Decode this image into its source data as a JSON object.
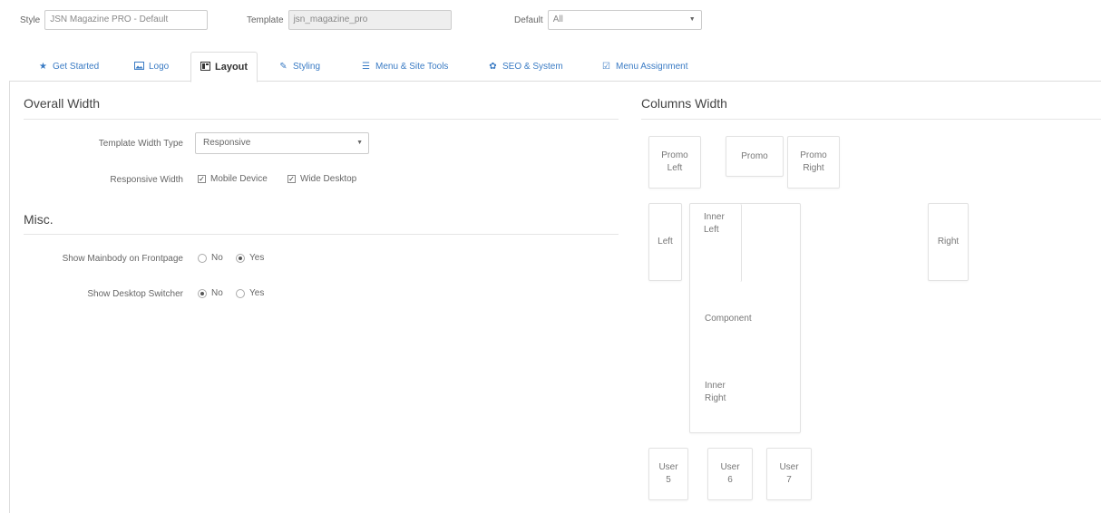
{
  "top": {
    "style_label": "Style",
    "style_value": "JSN Magazine PRO - Default",
    "template_label": "Template",
    "template_value": "jsn_magazine_pro",
    "default_label": "Default",
    "default_value": "All"
  },
  "tabs": [
    {
      "label": "Get Started",
      "icon": "star-icon"
    },
    {
      "label": "Logo",
      "icon": "image-icon"
    },
    {
      "label": "Layout",
      "icon": "layout-icon"
    },
    {
      "label": "Styling",
      "icon": "brush-icon"
    },
    {
      "label": "Menu & Site Tools",
      "icon": "list-icon"
    },
    {
      "label": "SEO & System",
      "icon": "gear-icon"
    },
    {
      "label": "Menu Assignment",
      "icon": "checkbox-icon"
    }
  ],
  "active_tab": "Layout",
  "overall_width": {
    "title": "Overall Width",
    "template_width_type_label": "Template Width Type",
    "template_width_type_value": "Responsive",
    "responsive_width_label": "Responsive Width",
    "mobile_device": "Mobile Device",
    "wide_desktop": "Wide Desktop"
  },
  "misc": {
    "title": "Misc.",
    "show_mainbody_label": "Show Mainbody on Frontpage",
    "show_desktop_switcher_label": "Show Desktop Switcher",
    "no": "No",
    "yes": "Yes",
    "show_mainbody_selected": "Yes",
    "show_desktop_switcher_selected": "No"
  },
  "columns_width": {
    "title": "Columns Width",
    "promo_left_1": "Promo",
    "promo_left_2": "Left",
    "promo": "Promo",
    "promo_right_1": "Promo",
    "promo_right_2": "Right",
    "left": "Left",
    "inner_left_1": "Inner",
    "inner_left_2": "Left",
    "component": "Component",
    "inner_right_1": "Inner",
    "inner_right_2": "Right",
    "right": "Right",
    "user5_1": "User",
    "user5_2": "5",
    "user6_1": "User",
    "user6_2": "6",
    "user7_1": "User",
    "user7_2": "7"
  },
  "colors": {
    "link": "#3a7bc4",
    "border": "#dddddd"
  }
}
